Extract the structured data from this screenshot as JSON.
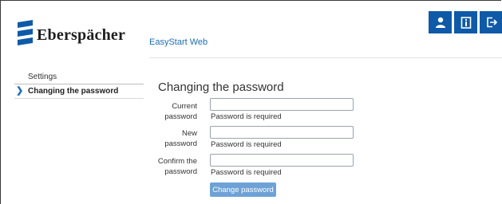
{
  "brand": {
    "logo_text": "Eberspächer",
    "app_name": "EasyStart Web",
    "accent": "#0f5aa8"
  },
  "header_buttons": [
    {
      "icon": "user-icon"
    },
    {
      "icon": "info-book-icon"
    },
    {
      "icon": "logout-icon"
    }
  ],
  "sidebar": {
    "items": [
      {
        "label": "Settings"
      },
      {
        "label": "Changing the password",
        "active": true
      }
    ]
  },
  "main": {
    "title": "Changing the password",
    "fields": [
      {
        "label_line1": "Current",
        "label_line2": "password",
        "value": "",
        "error": "Password is required"
      },
      {
        "label_line1": "New",
        "label_line2": "password",
        "value": "",
        "error": "Password is required"
      },
      {
        "label_line1": "Confirm the",
        "label_line2": "password",
        "value": "",
        "error": "Password is required"
      }
    ],
    "submit_label": "Change password"
  }
}
